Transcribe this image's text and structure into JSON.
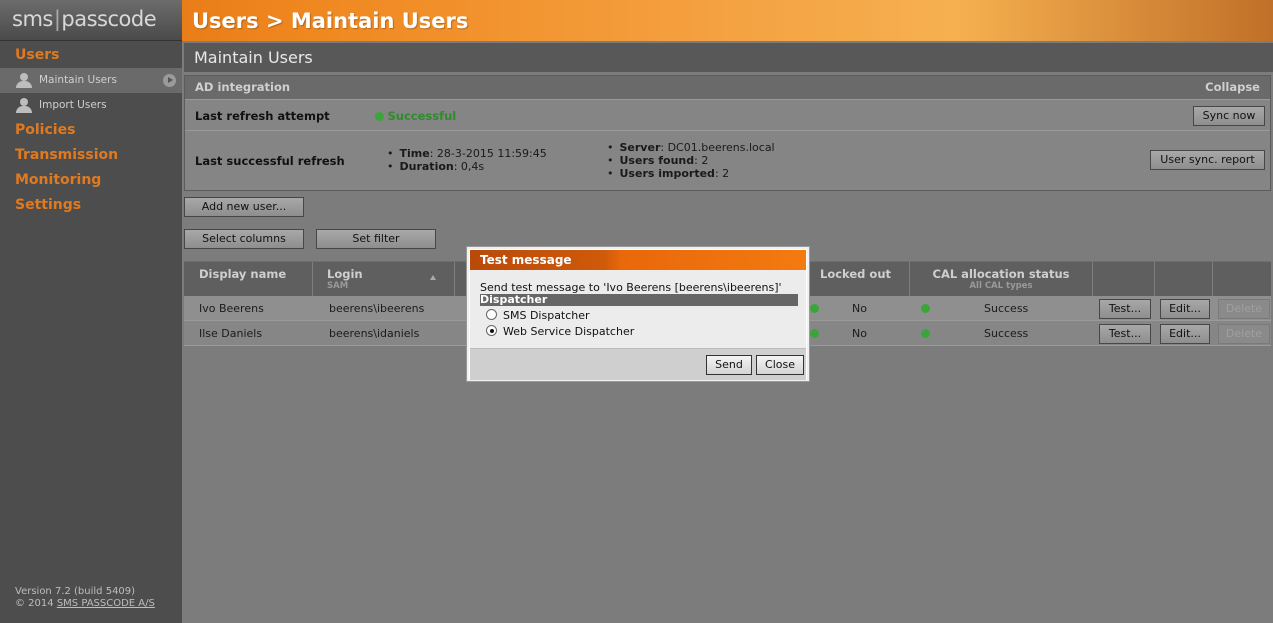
{
  "header": {
    "logo_left": "sms",
    "logo_right": "passcode",
    "title": "Users > Maintain Users"
  },
  "sidebar": {
    "groups": [
      {
        "label": "Users"
      },
      {
        "label": "Policies"
      },
      {
        "label": "Transmission"
      },
      {
        "label": "Monitoring"
      },
      {
        "label": "Settings"
      }
    ],
    "sub_items": [
      {
        "label": "Maintain Users",
        "active": true
      },
      {
        "label": "Import Users",
        "active": false
      }
    ],
    "version": "Version 7.2 (build 5409)",
    "copyright_prefix": "© 2014 ",
    "copyright_link": "SMS PASSCODE A/S"
  },
  "main": {
    "title": "Maintain Users",
    "ad": {
      "header": "AD integration",
      "collapse": "Collapse",
      "last_refresh_label": "Last refresh attempt",
      "last_refresh_status": "Successful",
      "sync_button": "Sync now",
      "last_success_label": "Last successful refresh",
      "time_label": "Time",
      "time_value": ": 28-3-2015 11:59:45",
      "duration_label": "Duration",
      "duration_value": ": 0,4s",
      "server_label": "Server",
      "server_value": ": DC01.beerens.local",
      "found_label": "Users found",
      "found_value": ": 2",
      "imported_label": "Users imported",
      "imported_value": ": 2",
      "report_button": "User sync. report"
    },
    "add_user_button": "Add new user...",
    "select_columns_button": "Select columns",
    "set_filter_button": "Set filter",
    "table": {
      "col_display": "Display name",
      "col_login": "Login",
      "col_login_sub": "SAM",
      "col_locked": "Locked out",
      "col_cal": "CAL allocation status",
      "col_cal_sub": "All CAL types",
      "test_label": "Test...",
      "edit_label": "Edit...",
      "delete_label": "Delete",
      "rows": [
        {
          "display": "Ivo Beerens",
          "login": "beerens\\ibeerens",
          "locked": "No",
          "cal": "Success"
        },
        {
          "display": "Ilse Daniels",
          "login": "beerens\\idaniels",
          "locked": "No",
          "cal": "Success"
        }
      ]
    }
  },
  "modal": {
    "title": "Test message",
    "message": "Send test message to 'Ivo Beerens [beerens\\ibeerens]'",
    "section": "Dispatcher",
    "options": [
      {
        "label": "SMS Dispatcher",
        "selected": false
      },
      {
        "label": "Web Service Dispatcher",
        "selected": true
      }
    ],
    "send_button": "Send",
    "close_button": "Close"
  }
}
